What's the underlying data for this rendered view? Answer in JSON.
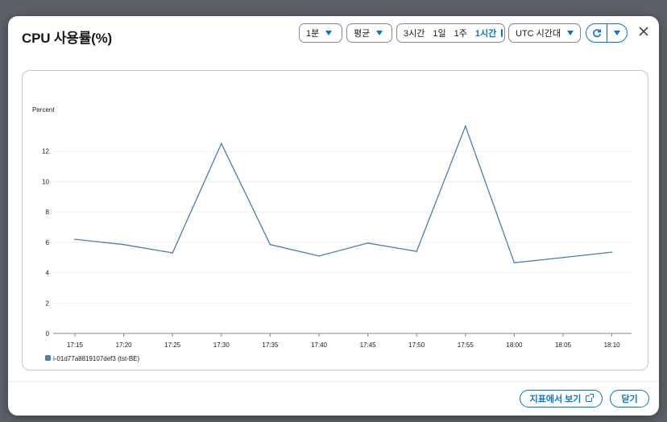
{
  "header": {
    "title": "CPU 사용률(%)",
    "period": "1분",
    "statistic": "평균",
    "ranges": [
      "3시간",
      "1일",
      "1주"
    ],
    "selected_range": "1시간",
    "timezone": "UTC 시간대"
  },
  "icons": {
    "calendar": "calendar-icon",
    "refresh": "refresh-icon",
    "dropdown": "chevron-down-icon",
    "close": "close-icon",
    "external": "external-link-icon"
  },
  "colors": {
    "accent": "#0972d3",
    "series": "#4a7fb0"
  },
  "footer": {
    "view_metrics": "지표에서 보기",
    "close": "닫기"
  },
  "chart_data": {
    "type": "line",
    "ylabel": "Percent",
    "ylim": [
      0,
      14
    ],
    "yticks": [
      0,
      2,
      4,
      6,
      8,
      10,
      12
    ],
    "xtick_labels": [
      "17:15",
      "17:20",
      "17:25",
      "17:30",
      "17:35",
      "17:40",
      "17:45",
      "17:50",
      "17:55",
      "18:00",
      "18:05",
      "18:10"
    ],
    "grid": true,
    "legend": "bottom-left",
    "series": [
      {
        "name": "i-01d77a8819107def3 (tst-BE)",
        "x": [
          "17:15",
          "17:20",
          "17:25",
          "17:30",
          "17:35",
          "17:40",
          "17:45",
          "17:50",
          "17:55",
          "18:00",
          "18:05",
          "18:10"
        ],
        "values": [
          6.2,
          5.85,
          5.3,
          12.5,
          5.85,
          5.1,
          5.95,
          5.4,
          13.65,
          4.65,
          5.0,
          5.35
        ]
      }
    ]
  }
}
